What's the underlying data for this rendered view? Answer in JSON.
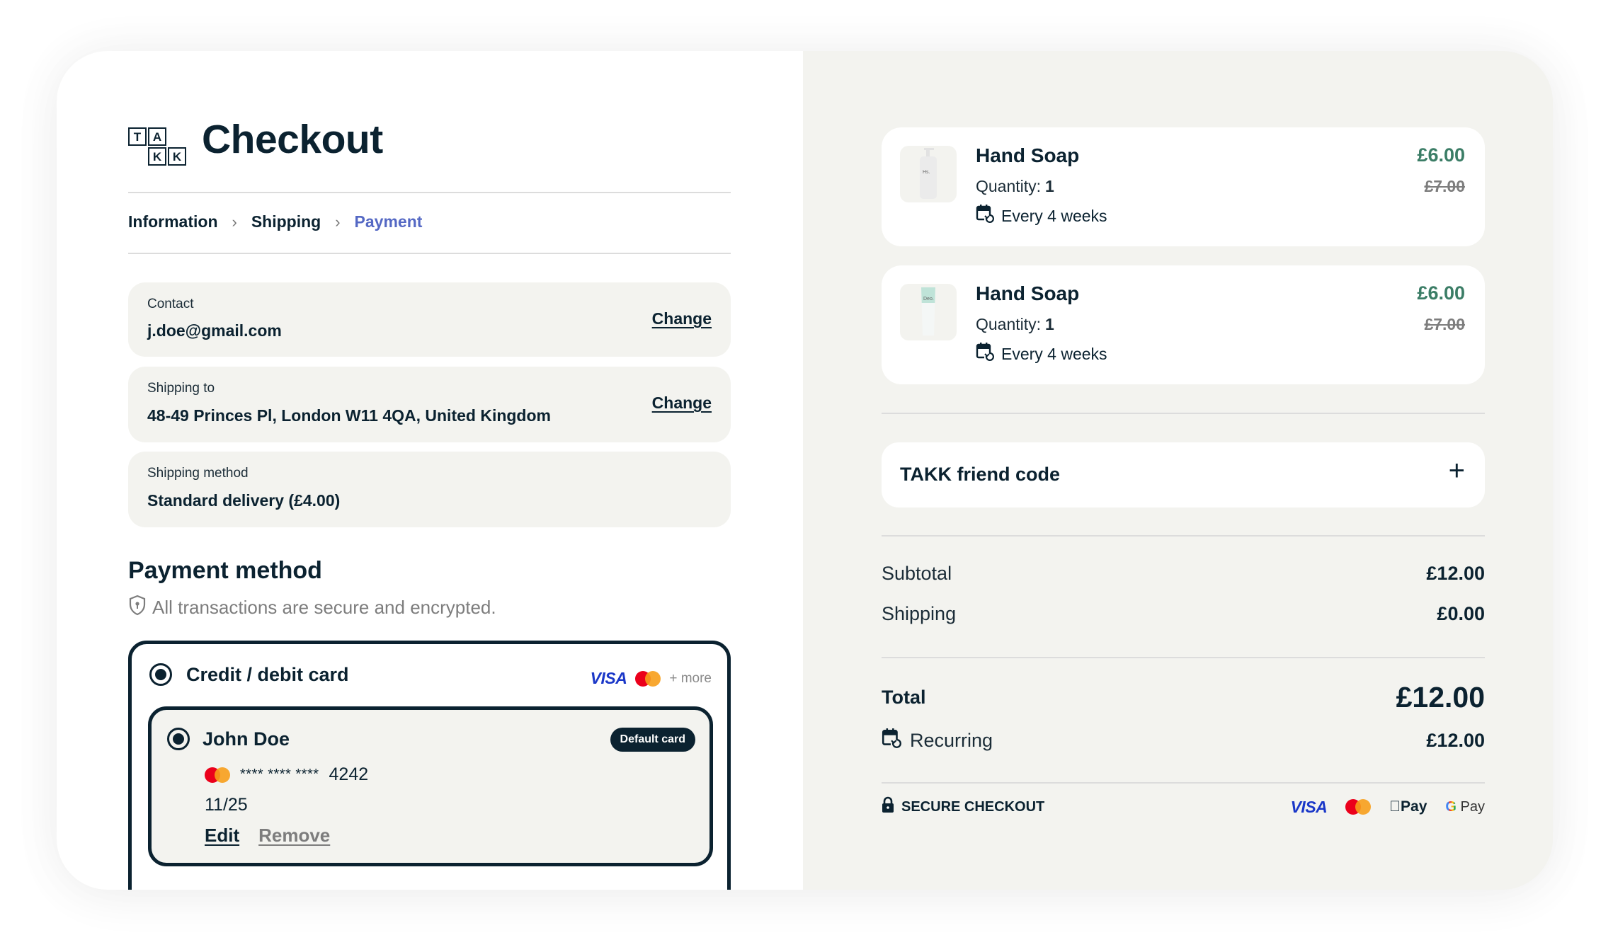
{
  "brand": {
    "logo_letters": [
      "T",
      "A",
      "K",
      "K"
    ],
    "title": "Checkout"
  },
  "breadcrumb": {
    "items": [
      "Information",
      "Shipping",
      "Payment"
    ],
    "active_index": 2
  },
  "summary_boxes": {
    "contact": {
      "label": "Contact",
      "value": "j.doe@gmail.com",
      "action": "Change"
    },
    "shipping_to": {
      "label": "Shipping to",
      "value": "48-49 Princes Pl, London W11 4QA, United Kingdom",
      "action": "Change"
    },
    "shipping_method": {
      "label": "Shipping method",
      "value": "Standard delivery (£4.00)"
    }
  },
  "payment": {
    "title": "Payment method",
    "subtitle": "All transactions are secure and encrypted.",
    "option_label": "Credit / debit card",
    "brands": [
      "VISA",
      "mastercard"
    ],
    "more_label": "+ more",
    "saved_card": {
      "name": "John Doe",
      "badge": "Default card",
      "masked": "**** **** ****",
      "last4": "4242",
      "expiry": "11/25",
      "edit_label": "Edit",
      "remove_label": "Remove"
    }
  },
  "cart": {
    "items": [
      {
        "name": "Hand Soap",
        "quantity_label": "Quantity:",
        "quantity": "1",
        "frequency": "Every 4 weeks",
        "price": "£6.00",
        "original_price": "£7.00",
        "thumb_label": "Hs."
      },
      {
        "name": "Hand Soap",
        "quantity_label": "Quantity:",
        "quantity": "1",
        "frequency": "Every 4 weeks",
        "price": "£6.00",
        "original_price": "£7.00",
        "thumb_label": "Deo."
      }
    ],
    "friend_code_label": "TAKK friend code",
    "subtotal_label": "Subtotal",
    "subtotal": "£12.00",
    "shipping_label": "Shipping",
    "shipping": "£0.00",
    "total_label": "Total",
    "total": "£12.00",
    "recurring_label": "Recurring",
    "recurring": "£12.00",
    "secure_label": "SECURE CHECKOUT",
    "footer_brands": [
      "VISA",
      "mastercard",
      "Apple Pay",
      "Google Pay"
    ]
  },
  "colors": {
    "ink": "#0b2230",
    "accent_blue": "#5468c4",
    "price_green": "#3b7d66",
    "panel_bg": "#f3f3ef"
  }
}
